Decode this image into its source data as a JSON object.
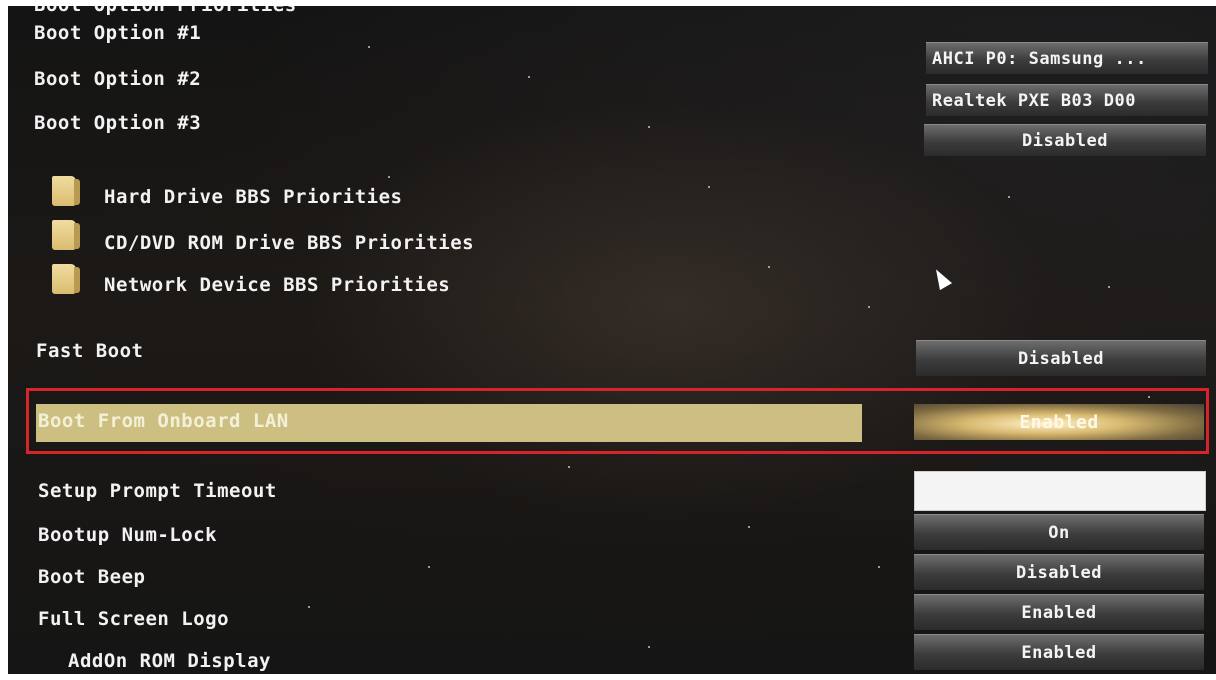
{
  "section_heading_partial": "Boot Option Priorities",
  "boot_options": [
    {
      "label": "Boot Option #1",
      "value": "AHCI P0: Samsung ..."
    },
    {
      "label": "Boot Option #2",
      "value": "Realtek PXE B03 D00"
    },
    {
      "label": "Boot Option #3",
      "value": "Disabled"
    }
  ],
  "submenus": [
    {
      "label": "Hard Drive BBS Priorities",
      "icon": "folder-icon"
    },
    {
      "label": "CD/DVD ROM Drive BBS Priorities",
      "icon": "folder-icon"
    },
    {
      "label": "Network Device BBS Priorities",
      "icon": "folder-icon"
    }
  ],
  "settings": {
    "fast_boot": {
      "label": "Fast Boot",
      "value": "Disabled"
    },
    "boot_from_lan": {
      "label": "Boot From Onboard LAN",
      "value": "Enabled"
    },
    "setup_prompt_timeout": {
      "label": "Setup Prompt Timeout",
      "value": ""
    },
    "bootup_numlock": {
      "label": "Bootup Num-Lock",
      "value": "On"
    },
    "boot_beep": {
      "label": "Boot Beep",
      "value": "Disabled"
    },
    "full_screen_logo": {
      "label": "Full Screen Logo",
      "value": "Enabled"
    },
    "addon_rom_display": {
      "label": "AddOn ROM Display",
      "value": "Enabled"
    }
  },
  "colors": {
    "highlight_bar": "#cdbf82",
    "annotation_frame": "#d9232a",
    "text": "#f2f2f2"
  }
}
